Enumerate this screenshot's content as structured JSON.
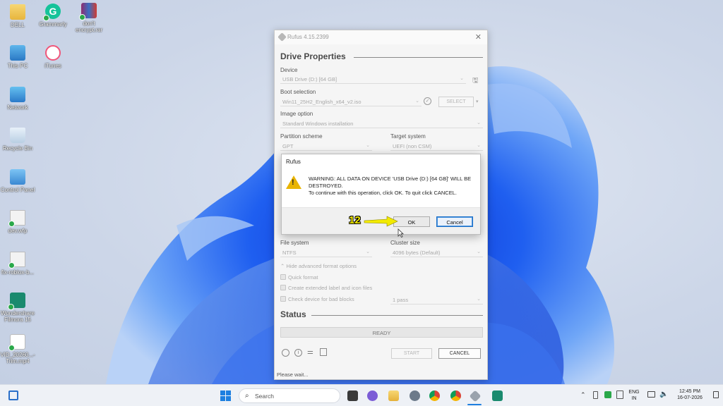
{
  "desktop": {
    "icons": [
      {
        "label": "DELL",
        "icon": "folder-icon"
      },
      {
        "label": "Grammarly",
        "icon": "grammarly-icon"
      },
      {
        "label": "don't encrypt.rar",
        "icon": "winrar-archive-icon"
      },
      {
        "label": "This PC",
        "icon": "this-pc-icon"
      },
      {
        "label": "iTunes",
        "icon": "itunes-icon"
      },
      {
        "label": "Network",
        "icon": "network-icon"
      },
      {
        "label": "Recycle Bin",
        "icon": "recycle-bin-icon"
      },
      {
        "label": "Control Panel",
        "icon": "control-panel-icon"
      },
      {
        "label": "dev.wfp",
        "icon": "file-icon"
      },
      {
        "label": "fix-roblox-b...",
        "icon": "file-icon"
      },
      {
        "label": "Wondershare Filmora 15",
        "icon": "filmora-icon"
      },
      {
        "label": "VID_20260...-Trim.mp4",
        "icon": "video-file-icon"
      }
    ]
  },
  "rufus": {
    "title": "Rufus 4.15.2399",
    "drive_properties": "Drive Properties",
    "device_label": "Device",
    "device_value": "USB Drive (D:) [64 GB]",
    "boot_label": "Boot selection",
    "boot_value": "Win11_25H2_English_x64_v2.iso",
    "select_button": "SELECT",
    "image_option_label": "Image option",
    "image_option_value": "Standard Windows installation",
    "partition_label": "Partition scheme",
    "partition_value": "GPT",
    "target_label": "Target system",
    "target_value": "UEFI (non CSM)",
    "filesystem_label": "File system",
    "filesystem_value": "NTFS",
    "cluster_label": "Cluster size",
    "cluster_value": "4096 bytes (Default)",
    "hide_advanced": "Hide advanced format options",
    "quick_format": "Quick format",
    "extended_label": "Create extended label and icon files",
    "check_bad_blocks": "Check device for bad blocks",
    "passes": "1 pass",
    "status_heading": "Status",
    "status_value": "READY",
    "start_button": "START",
    "cancel_button": "CANCEL",
    "status_bar": "Please wait..."
  },
  "dialog": {
    "title": "Rufus",
    "message_line1": "WARNING: ALL DATA ON DEVICE 'USB Drive (D:) [64 GB]' WILL BE DESTROYED.",
    "message_line2": "To continue with this operation, click OK. To quit click CANCEL.",
    "ok_button": "OK",
    "cancel_button": "Cancel",
    "icon": "warning-icon"
  },
  "annotation": {
    "step": "12",
    "color": "#f2ea00"
  },
  "taskbar": {
    "search_placeholder": "Search",
    "language": "ENG",
    "region": "IN",
    "time": "12:45 PM",
    "date": "16-07-2026"
  }
}
